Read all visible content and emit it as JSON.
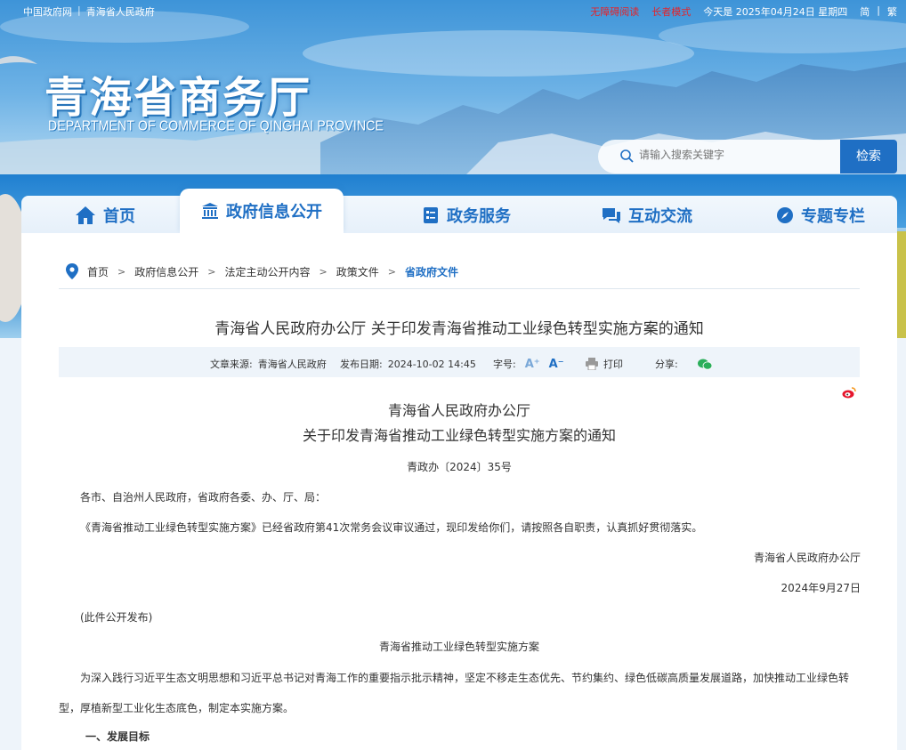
{
  "topbar": {
    "gov_link": "中国政府网",
    "sep": "|",
    "prov_link": "青海省人民政府",
    "barrier_free": "无障碍阅读",
    "elder_mode": "长者模式",
    "today": "今天是 2025年04月24日 星期四",
    "simplified": "简",
    "lang_sep": "|",
    "traditional": "繁"
  },
  "logo": {
    "cn": "青海省商务厅",
    "en": "DEPARTMENT OF COMMERCE OF QINGHAI PROVINCE"
  },
  "search": {
    "placeholder": "请输入搜索关键字",
    "button": "检索"
  },
  "nav": {
    "items": [
      {
        "label": "首页",
        "icon": "home-icon"
      },
      {
        "label": "政府信息公开",
        "icon": "government-building-icon"
      },
      {
        "label": "政务服务",
        "icon": "service-list-icon"
      },
      {
        "label": "互动交流",
        "icon": "chat-icon"
      },
      {
        "label": "专题专栏",
        "icon": "compass-icon"
      }
    ],
    "active_index": 1
  },
  "breadcrumb": {
    "items": [
      "首页",
      "政府信息公开",
      "法定主动公开内容",
      "政策文件",
      "省政府文件"
    ],
    "separator": ">"
  },
  "article": {
    "title": "青海省人民政府办公厅 关于印发青海省推动工业绿色转型实施方案的通知",
    "meta": {
      "source_label": "文章来源:",
      "source": "青海省人民政府",
      "date_label": "发布日期:",
      "date": "2024-10-02 14:45",
      "fontsize_label": "字号:",
      "font_up": "A⁺",
      "font_down": "A⁻",
      "print": "打印",
      "share_label": "分享:"
    },
    "doc_title_1": "青海省人民政府办公厅",
    "doc_title_2": "关于印发青海省推动工业绿色转型实施方案的通知",
    "doc_number": "青政办〔2024〕35号",
    "addressee": "各市、自治州人民政府，省政府各委、办、厅、局：",
    "body_1": "《青海省推动工业绿色转型实施方案》已经省政府第41次常务会议审议通过，现印发给你们，请按照各自职责，认真抓好贯彻落实。",
    "signer": "青海省人民政府办公厅",
    "sign_date": "2024年9月27日",
    "publish_note": "(此件公开发布)",
    "plan_title": "青海省推动工业绿色转型实施方案",
    "intro_line_1": "为深入践行习近平生态文明思想和习近平总书记对青海工作的重要指示批示精神，坚定不移走生态优先、节约集约、绿色低碳高质量发展道路，加快推动工业绿色转",
    "intro_line_2": "型，厚植新型工业化生态底色，制定本实施方案。",
    "section_1": "一、发展目标"
  },
  "colors": {
    "brand_blue": "#1f6fc4",
    "alert_red": "#e3242b",
    "meta_bg": "#eef4fa"
  }
}
